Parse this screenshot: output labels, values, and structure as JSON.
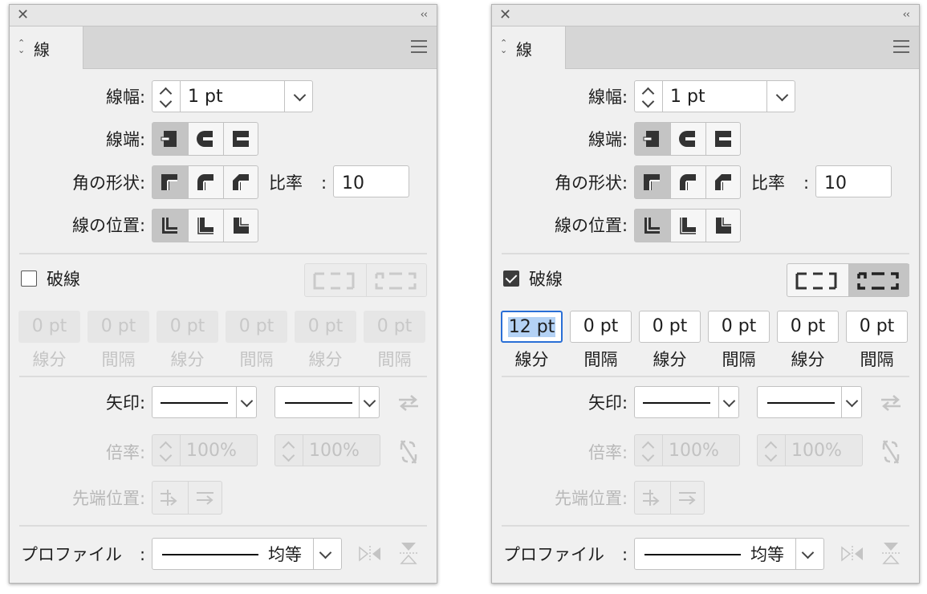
{
  "panels": [
    {
      "tab": "線",
      "stroke_weight": {
        "label": "線幅",
        "value": "1 pt"
      },
      "cap": {
        "label": "線端"
      },
      "corner": {
        "label": "角の形状",
        "limit_label": "比率",
        "limit_value": "10"
      },
      "align": {
        "label": "線の位置"
      },
      "dashed": {
        "label": "破線",
        "checked": false
      },
      "dash_fields": [
        {
          "value": "0 pt",
          "label": "線分"
        },
        {
          "value": "0 pt",
          "label": "間隔"
        },
        {
          "value": "0 pt",
          "label": "線分"
        },
        {
          "value": "0 pt",
          "label": "間隔"
        },
        {
          "value": "0 pt",
          "label": "線分"
        },
        {
          "value": "0 pt",
          "label": "間隔"
        }
      ],
      "arrows": {
        "label": "矢印"
      },
      "scale": {
        "label": "倍率",
        "start": "100%",
        "end": "100%"
      },
      "tip": {
        "label": "先端位置"
      },
      "profile": {
        "label": "プロファイル",
        "value": "均等"
      }
    },
    {
      "tab": "線",
      "stroke_weight": {
        "label": "線幅",
        "value": "1 pt"
      },
      "cap": {
        "label": "線端"
      },
      "corner": {
        "label": "角の形状",
        "limit_label": "比率",
        "limit_value": "10"
      },
      "align": {
        "label": "線の位置"
      },
      "dashed": {
        "label": "破線",
        "checked": true
      },
      "dash_fields": [
        {
          "value": "12 pt",
          "label": "線分"
        },
        {
          "value": "0 pt",
          "label": "間隔"
        },
        {
          "value": "0 pt",
          "label": "線分"
        },
        {
          "value": "0 pt",
          "label": "間隔"
        },
        {
          "value": "0 pt",
          "label": "線分"
        },
        {
          "value": "0 pt",
          "label": "間隔"
        }
      ],
      "arrows": {
        "label": "矢印"
      },
      "scale": {
        "label": "倍率",
        "start": "100%",
        "end": "100%"
      },
      "tip": {
        "label": "先端位置"
      },
      "profile": {
        "label": "プロファイル",
        "value": "均等"
      }
    }
  ],
  "icons": {
    "close": "close-icon",
    "collapse": "double-chevron-left-icon",
    "menu": "hamburger-menu-icon",
    "swap": "swap-arrows-icon",
    "unlink": "unlink-icon"
  },
  "colors": {
    "focus": "#2a6fd6",
    "selection_highlight": "#b4d2f5",
    "selected_button": "#c4c4c4"
  }
}
